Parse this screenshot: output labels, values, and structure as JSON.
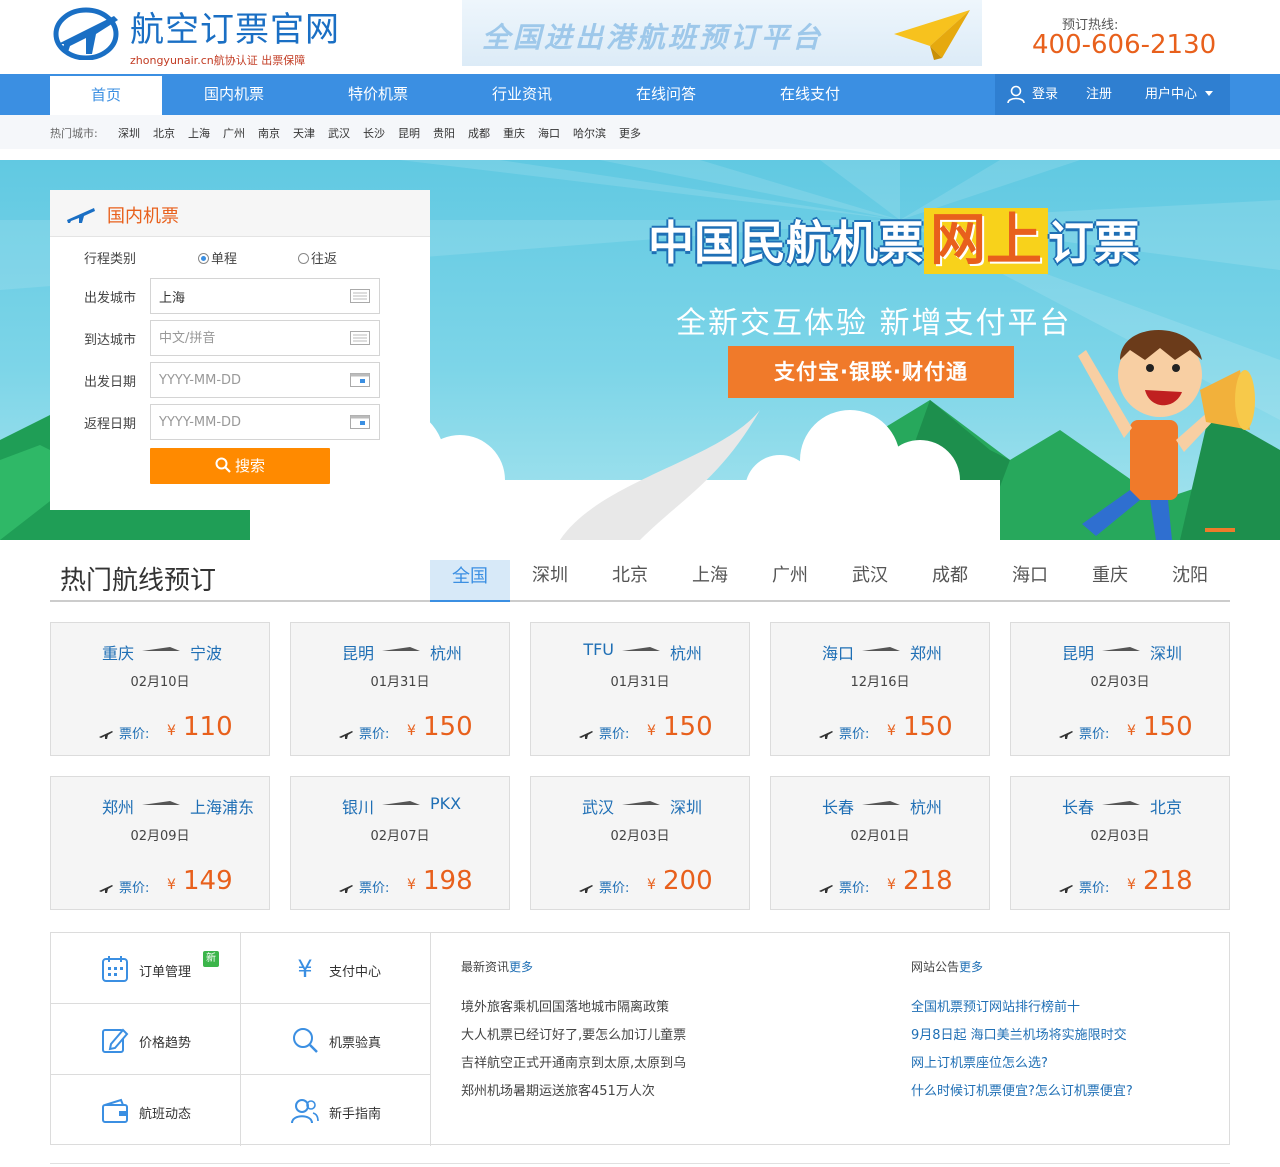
{
  "header": {
    "logo_title": "航空订票官网",
    "logo_sub": "zhongyunair.cn航协认证 出票保障",
    "slogan": "全国进出港航班预订平台",
    "hotline_label": "预订热线:",
    "hotline_number": "400-606-2130"
  },
  "nav": {
    "items": [
      "首页",
      "国内机票",
      "特价机票",
      "行业资讯",
      "在线问答",
      "在线支付"
    ],
    "active_index": 0,
    "login": "登录",
    "register": "注册",
    "user_center": "用户中心"
  },
  "hot_cities": {
    "label": "热门城市:",
    "cities": [
      "深圳",
      "北京",
      "上海",
      "广州",
      "南京",
      "天津",
      "武汉",
      "长沙",
      "昆明",
      "贵阳",
      "成都",
      "重庆",
      "海口",
      "哈尔滨",
      "更多"
    ]
  },
  "hero": {
    "title_a": "中国民航机票",
    "title_b": "网上",
    "title_c": "订票",
    "subtitle": "全新交互体验  新增支付平台",
    "payments": "支付宝·银联·财付通"
  },
  "search": {
    "title": "国内机票",
    "trip_type_label": "行程类别",
    "one_way": "单程",
    "round_trip": "往返",
    "selected": "单程",
    "from_label": "出发城市",
    "from_value": "上海",
    "to_label": "到达城市",
    "to_placeholder": "中文/拼音",
    "depart_label": "出发日期",
    "depart_placeholder": "YYYY-MM-DD",
    "return_label": "返程日期",
    "return_placeholder": "YYYY-MM-DD",
    "button": "搜索"
  },
  "routes": {
    "title": "热门航线预订",
    "tabs": [
      "全国",
      "深圳",
      "北京",
      "上海",
      "广州",
      "武汉",
      "成都",
      "海口",
      "重庆",
      "沈阳"
    ],
    "active_tab": 0,
    "price_label": "票价:",
    "currency": "¥",
    "cards": [
      {
        "from": "重庆",
        "to": "宁波",
        "date": "02月10日",
        "price": "110"
      },
      {
        "from": "昆明",
        "to": "杭州",
        "date": "01月31日",
        "price": "150"
      },
      {
        "from": "TFU",
        "to": "杭州",
        "date": "01月31日",
        "price": "150"
      },
      {
        "from": "海口",
        "to": "郑州",
        "date": "12月16日",
        "price": "150"
      },
      {
        "from": "昆明",
        "to": "深圳",
        "date": "02月03日",
        "price": "150"
      },
      {
        "from": "郑州",
        "to": "上海浦东",
        "date": "02月09日",
        "price": "149"
      },
      {
        "from": "银川",
        "to": "PKX",
        "date": "02月07日",
        "price": "198"
      },
      {
        "from": "武汉",
        "to": "深圳",
        "date": "02月03日",
        "price": "200"
      },
      {
        "from": "长春",
        "to": "杭州",
        "date": "02月01日",
        "price": "218"
      },
      {
        "from": "长春",
        "to": "北京",
        "date": "02月03日",
        "price": "218"
      }
    ]
  },
  "services": {
    "items": [
      {
        "label": "订单管理",
        "icon": "calendar-icon",
        "badge": "新"
      },
      {
        "label": "支付中心",
        "icon": "yen-icon"
      },
      {
        "label": "价格趋势",
        "icon": "edit-icon"
      },
      {
        "label": "机票验真",
        "icon": "search-icon"
      },
      {
        "label": "航班动态",
        "icon": "wallet-icon"
      },
      {
        "label": "新手指南",
        "icon": "users-icon"
      }
    ]
  },
  "news": {
    "title": "最新资讯",
    "more": "更多",
    "items": [
      "境外旅客乘机回国落地城市隔离政策",
      "大人机票已经订好了,要怎么加订儿童票",
      "吉祥航空正式开通南京到太原,太原到乌",
      "郑州机场暑期运送旅客451万人次"
    ]
  },
  "notices": {
    "title": "网站公告",
    "more": "更多",
    "items": [
      "全国机票预订网站排行榜前十",
      "9月8日起 海口美兰机场将实施限时交",
      "网上订机票座位怎么选?",
      "什么时候订机票便宜?怎么订机票便宜?"
    ]
  },
  "colors": {
    "nav_blue": "#3b8fe2",
    "accent_orange": "#e8601c",
    "button_orange": "#ff8a00",
    "link_blue": "#1f6fb5"
  }
}
